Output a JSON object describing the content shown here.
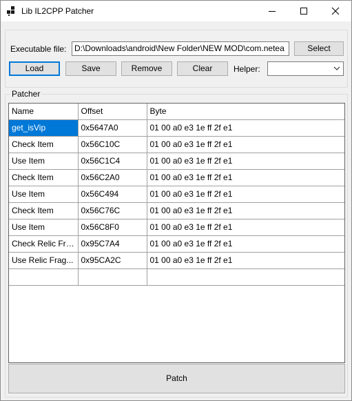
{
  "window": {
    "title": "Lib IL2CPP Patcher",
    "icon": "app-icon"
  },
  "top": {
    "executable_label": "Executable file:",
    "executable_value": "D:\\Downloads\\android\\New Folder\\NEW MOD\\com.netea",
    "select_label": "Select",
    "load_label": "Load",
    "save_label": "Save",
    "remove_label": "Remove",
    "clear_label": "Clear",
    "helper_label": "Helper:",
    "helper_value": ""
  },
  "patcher": {
    "group_label": "Patcher",
    "columns": [
      "Name",
      "Offset",
      "Byte"
    ],
    "rows": [
      {
        "name": "get_isVip",
        "offset": "0x5647A0",
        "byte": "01 00 a0 e3 1e ff 2f e1"
      },
      {
        "name": "Check Item",
        "offset": "0x56C10C",
        "byte": "01 00 a0 e3 1e ff 2f e1"
      },
      {
        "name": "Use Item",
        "offset": "0x56C1C4",
        "byte": "01 00 a0 e3 1e ff 2f e1"
      },
      {
        "name": "Check Item",
        "offset": "0x56C2A0",
        "byte": "01 00 a0 e3 1e ff 2f e1"
      },
      {
        "name": "Use Item",
        "offset": "0x56C494",
        "byte": "01 00 a0 e3 1e ff 2f e1"
      },
      {
        "name": "Check Item",
        "offset": "0x56C76C",
        "byte": "01 00 a0 e3 1e ff 2f e1"
      },
      {
        "name": "Use Item",
        "offset": "0x56C8F0",
        "byte": "01 00 a0 e3 1e ff 2f e1"
      },
      {
        "name": "Check Relic Fra...",
        "offset": "0x95C7A4",
        "byte": "01 00 a0 e3 1e ff 2f e1"
      },
      {
        "name": "Use Relic Frag...",
        "offset": "0x95CA2C",
        "byte": "01 00 a0 e3 1e ff 2f e1"
      }
    ],
    "patch_label": "Patch"
  },
  "colors": {
    "selection": "#0078d7",
    "button_face": "#e1e1e1",
    "window_bg": "#f0f0f0"
  }
}
